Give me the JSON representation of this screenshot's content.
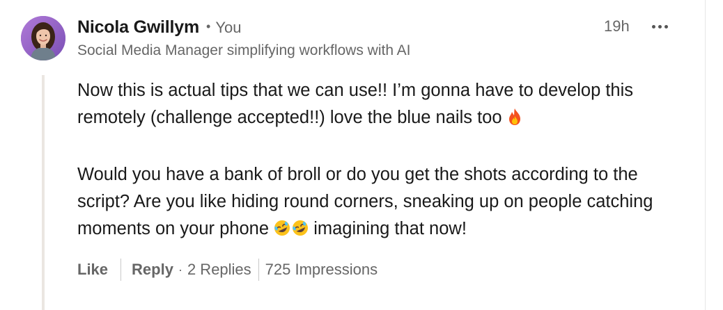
{
  "comment": {
    "author": {
      "name": "Nicola Gwillym",
      "relationship": "You",
      "headline": "Social Media Manager simplifying workflows with AI",
      "avatar_icon": "profile-photo-avatar"
    },
    "timestamp": "19h",
    "more_icon": "ellipsis-icon",
    "paragraphs": [
      {
        "text": "Now this is actual tips that we can use!! I’m gonna have to develop this remotely (challenge accepted!!) love the blue nails too",
        "trailing_emoji": "fire-emoji"
      },
      {
        "text_before_emoji": "Would you have a bank of broll or do you get the shots according to the script? Are you like hiding round corners, sneaking up on people catching moments on your phone",
        "emoji": "rolling-on-floor-laughing-emoji x2",
        "text_after_emoji": "imagining that now!"
      }
    ],
    "actions": {
      "like_label": "Like",
      "reply_label": "Reply",
      "separator": "·",
      "replies_label": "2 Replies",
      "impressions_label": "725 Impressions"
    }
  },
  "colors": {
    "primary_text": "#191919",
    "secondary_text": "#666666",
    "thread_line": "#ebe6e1",
    "divider": "#c8c8c8",
    "avatar_bg": "#9a68c8"
  }
}
